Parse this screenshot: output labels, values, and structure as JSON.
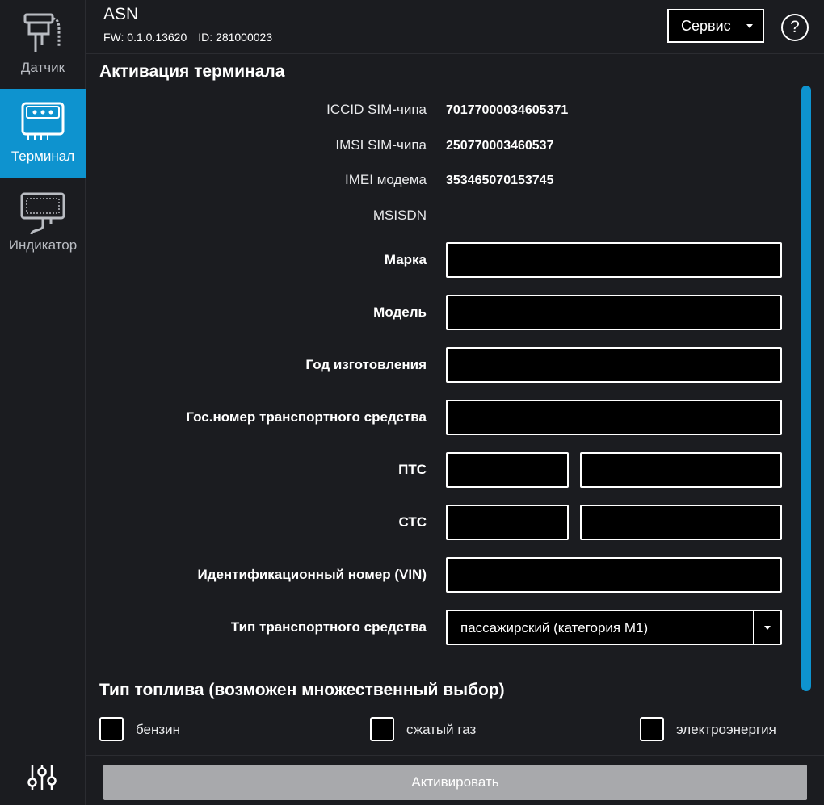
{
  "sidebar": {
    "items": [
      {
        "label": "Датчик",
        "icon": "sensor-icon"
      },
      {
        "label": "Терминал",
        "icon": "terminal-icon"
      },
      {
        "label": "Индикатор",
        "icon": "indicator-icon"
      }
    ],
    "bottom_icon": "settings-sliders-icon"
  },
  "header": {
    "title": "ASN",
    "fw": "FW: 0.1.0.13620",
    "id": "ID: 281000023",
    "service_label": "Сервис",
    "help_label": "?"
  },
  "activation": {
    "title": "Активация терминала",
    "iccid_label": "ICCID SIM-чипа",
    "iccid_value": "70177000034605371",
    "imsi_label": "IMSI SIM-чипа",
    "imsi_value": "250770003460537",
    "imei_label": "IMEI модема",
    "imei_value": "353465070153745",
    "msisdn_label": "MSISDN",
    "brand_label": "Марка",
    "model_label": "Модель",
    "year_label": "Год изготовления",
    "plate_label": "Гос.номер транспортного средства",
    "pts_label": "ПТС",
    "sts_label": "СТС",
    "vin_label": "Идентификационный номер (VIN)",
    "vehicle_type_label": "Тип транспортного средства",
    "vehicle_type_value": "пассажирский (категория М1)"
  },
  "fuel": {
    "title": "Тип топлива (возможен множественный выбор)",
    "options": [
      "бензин",
      "сжатый газ",
      "электроэнергия"
    ]
  },
  "footer": {
    "activate_label": "Активировать"
  },
  "colors": {
    "background": "#1b1c20",
    "accent": "#0e93cf",
    "button_disabled": "#a8a9ac"
  }
}
